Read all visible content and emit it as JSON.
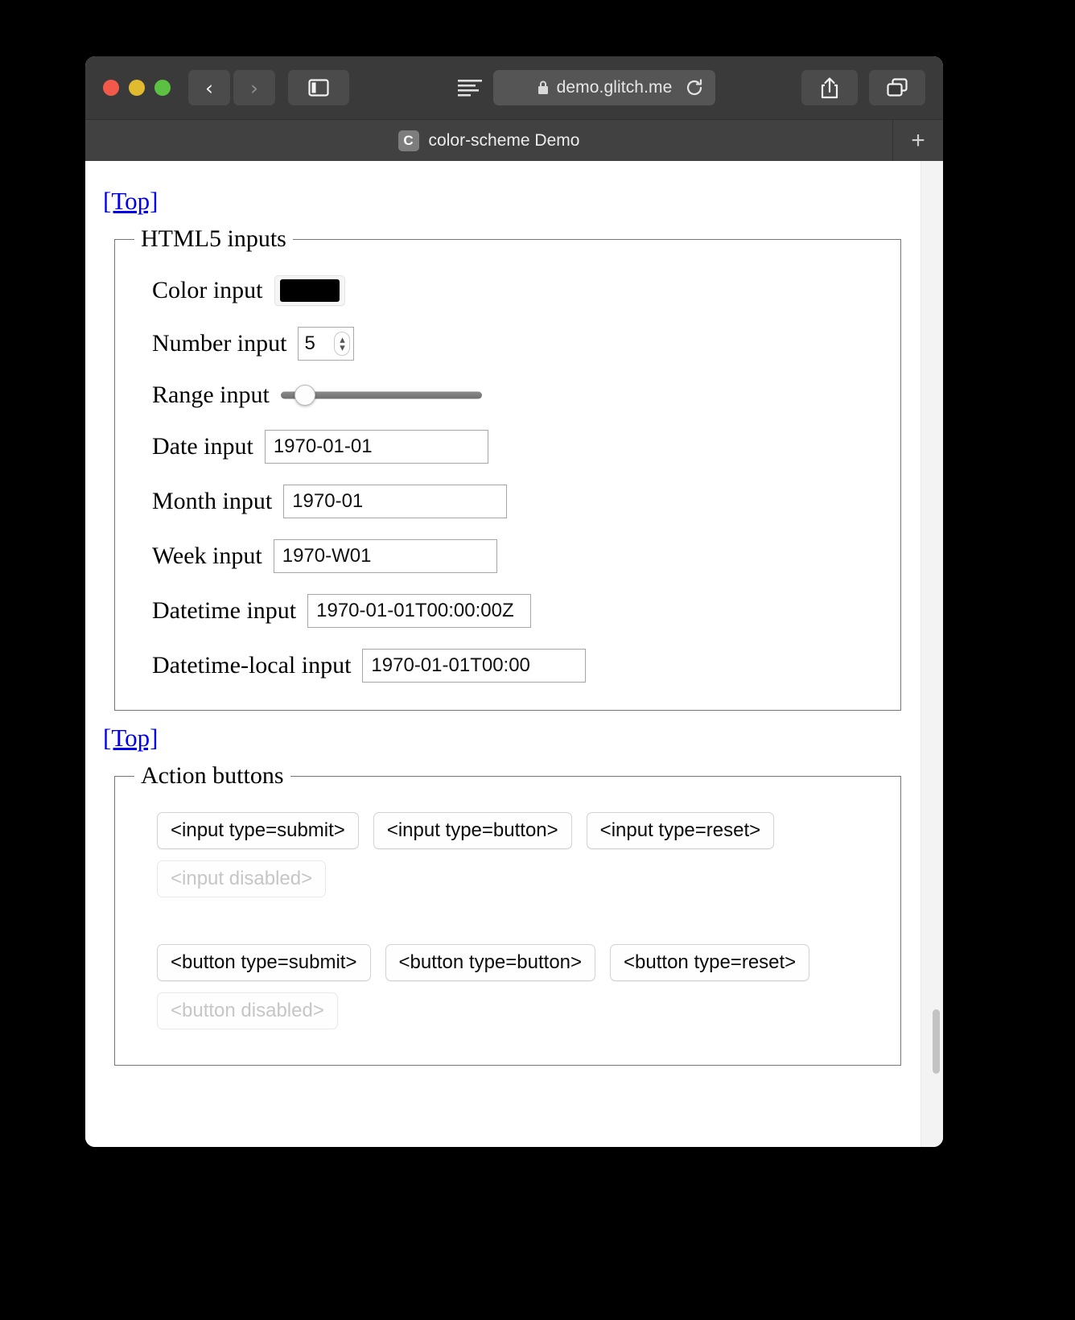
{
  "browser": {
    "window_controls": [
      {
        "name": "close",
        "color": "#f2594b"
      },
      {
        "name": "minimize",
        "color": "#e0bb2f"
      },
      {
        "name": "zoom",
        "color": "#5cc143"
      }
    ],
    "back_glyph": "‹",
    "forward_glyph": "›",
    "url": "demo.glitch.me",
    "url_secure": true,
    "new_tab_glyph": "+",
    "tabs": [
      {
        "favicon_letter": "C",
        "title": "color-scheme Demo",
        "active": true
      }
    ]
  },
  "page": {
    "top_link_1": "[Top]",
    "top_link_2": "[Top]",
    "sections": [
      {
        "legend": "HTML5 inputs",
        "rows": [
          {
            "label": "Color input",
            "kind": "color",
            "value": "#000000"
          },
          {
            "label": "Number input",
            "kind": "number",
            "value": "5"
          },
          {
            "label": "Range input",
            "kind": "range",
            "value": "12"
          },
          {
            "label": "Date input",
            "kind": "text",
            "value": "1970-01-01"
          },
          {
            "label": "Month input",
            "kind": "text",
            "value": "1970-01"
          },
          {
            "label": "Week input",
            "kind": "text",
            "value": "1970-W01"
          },
          {
            "label": "Datetime input",
            "kind": "text",
            "value": "1970-01-01T00:00:00Z"
          },
          {
            "label": "Datetime-local input",
            "kind": "text",
            "value": "1970-01-01T00:00"
          }
        ]
      },
      {
        "legend": "Action buttons",
        "input_buttons_row1": [
          "<input type=submit>",
          "<input type=button>",
          "<input type=reset>"
        ],
        "input_buttons_row2": [
          "<input disabled>"
        ],
        "button_buttons_row1": [
          "<button type=submit>",
          "<button type=button>",
          "<button type=reset>"
        ],
        "button_buttons_row2": [
          "<button disabled>"
        ]
      }
    ]
  },
  "colors": {
    "link": "#0000ee",
    "toolbar_bg": "#3a3a3a",
    "tabbar_bg": "#414141",
    "color_swatch": "#000000"
  }
}
